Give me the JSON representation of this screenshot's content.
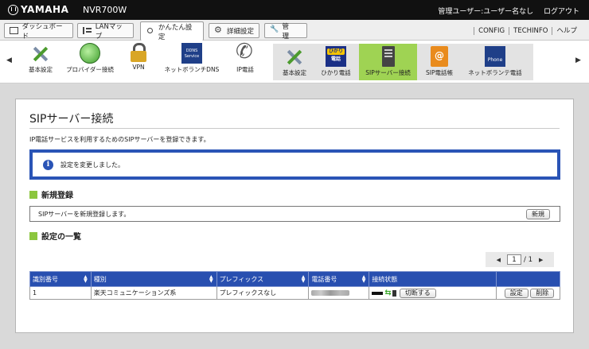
{
  "header": {
    "brand": "YAMAHA",
    "model": "NVR700W",
    "user": "管理ユーザー:ユーザー名なし",
    "logout": "ログアウト"
  },
  "tabs": {
    "dashboard": "ダッシュボード",
    "lanmap": "LANマップ",
    "easy": "かんたん設定",
    "detail": "詳細設定",
    "admin": "管　理"
  },
  "links": {
    "config": "CONFIG",
    "techinfo": "TECHINFO",
    "help": "ヘルプ"
  },
  "iconbar": {
    "left_arrow": "◀",
    "right_arrow": "▶",
    "items": [
      {
        "label": "基本設定",
        "icon": "tools-icon"
      },
      {
        "label": "プロバイダー接続",
        "icon": "globe-icon"
      },
      {
        "label": "VPN",
        "icon": "lock-icon"
      },
      {
        "label": "ネットボランチDNS",
        "icon": "ddns-icon"
      },
      {
        "label": "IP電話",
        "icon": "phone-icon"
      }
    ],
    "sub_items": [
      {
        "label": "基本設定",
        "icon": "tools-icon"
      },
      {
        "label": "ひかり電話",
        "icon": "hikari-phone-icon"
      },
      {
        "label": "SIPサーバー接続",
        "icon": "sip-server-icon",
        "selected": true
      },
      {
        "label": "SIP電話帳",
        "icon": "phonebook-icon"
      },
      {
        "label": "ネットボランテ電話",
        "icon": "netvolante-phone-icon"
      }
    ],
    "ddns_text": "DDNS Service",
    "hikari_top": "ひかり",
    "hikari_bottom": "電話",
    "np_text": "Phone",
    "selected_color": "#9fd353"
  },
  "main": {
    "title": "SIPサーバー接続",
    "description": "IP電話サービスを利用するためのSIPサーバーを登録できます。",
    "notice": "設定を変更しました。",
    "new_section": "新規登録",
    "new_text": "SIPサーバーを新規登録します。",
    "new_button": "新規",
    "list_section": "設定の一覧",
    "pager": {
      "prev": "◀",
      "current": "1",
      "total": "/ 1",
      "next": "▶"
    },
    "columns": [
      "識別番号",
      "種別",
      "プレフィックス",
      "電話番号",
      "接続状態"
    ],
    "rows": [
      {
        "id": "1",
        "type": "楽天コミュニケーションズ系",
        "prefix": "プレフィックスなし",
        "disconnect": "切断する",
        "edit": "設定",
        "delete": "削除"
      }
    ]
  },
  "colors": {
    "accent": "#2a54b6",
    "section_marker": "#8cc63f",
    "header_bg": "#111111"
  }
}
